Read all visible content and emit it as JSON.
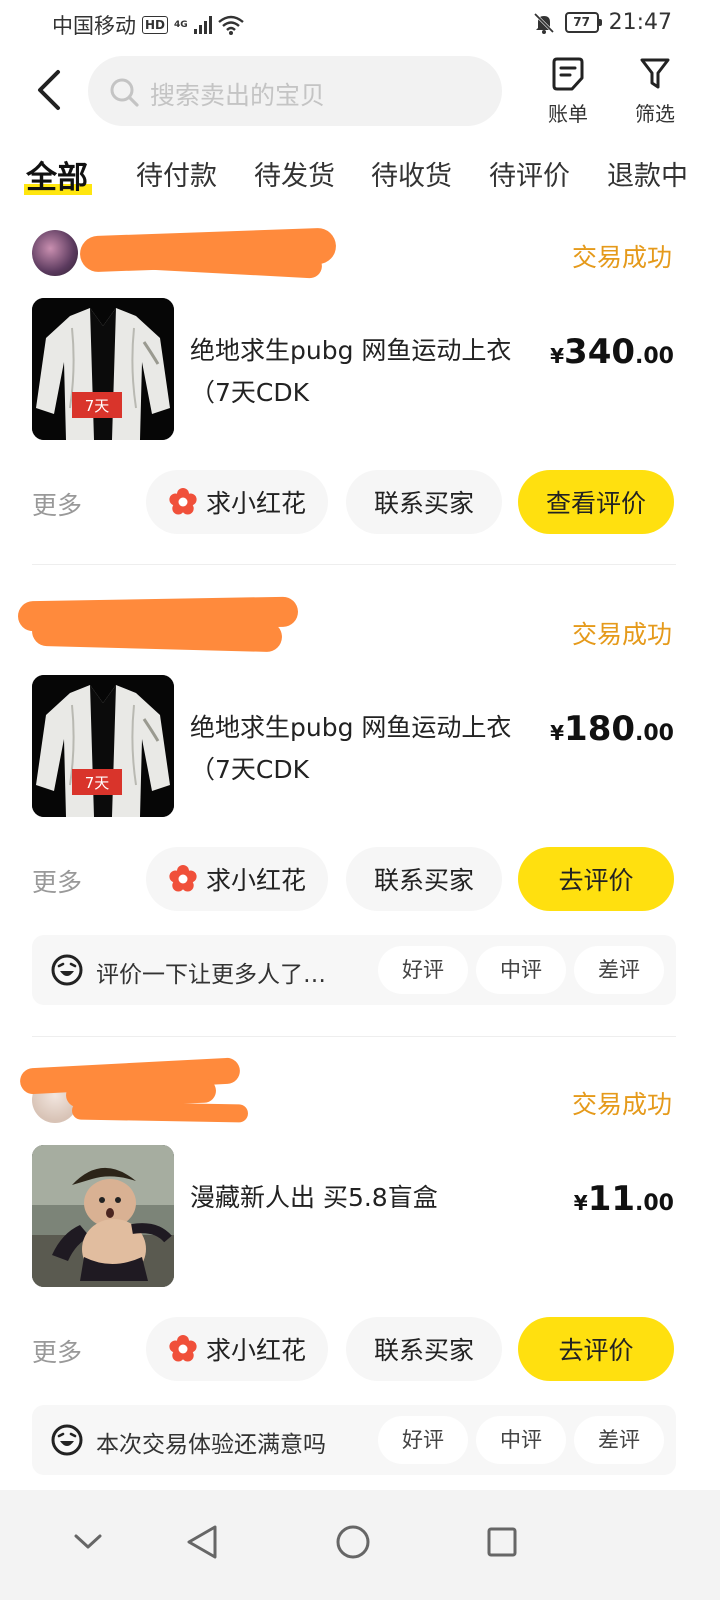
{
  "status_bar": {
    "carrier": "中国移动",
    "hd": "HD",
    "network": "4G",
    "battery": "77",
    "time": "21:47"
  },
  "header": {
    "search_placeholder": "搜索卖出的宝贝",
    "bill_label": "账单",
    "filter_label": "筛选"
  },
  "tabs": [
    {
      "label": "全部",
      "active": true
    },
    {
      "label": "待付款"
    },
    {
      "label": "待发货"
    },
    {
      "label": "待收货"
    },
    {
      "label": "待评价"
    },
    {
      "label": "退款中"
    }
  ],
  "orders": [
    {
      "status": "交易成功",
      "title": "绝地求生pubg 网鱼运动上衣（7天CDK",
      "thumb_badge": "7天",
      "price_currency": "¥",
      "price_int": "340",
      "price_dec": ".00",
      "more_label": "更多",
      "flower_label": "求小红花",
      "contact_label": "联系买家",
      "primary_label": "查看评价"
    },
    {
      "status": "交易成功",
      "title": "绝地求生pubg 网鱼运动上衣（7天CDK",
      "thumb_badge": "7天",
      "price_currency": "¥",
      "price_int": "180",
      "price_dec": ".00",
      "more_label": "更多",
      "flower_label": "求小红花",
      "contact_label": "联系买家",
      "primary_label": "去评价",
      "rate_prompt": "评价一下让更多人了…",
      "rate_good": "好评",
      "rate_mid": "中评",
      "rate_bad": "差评"
    },
    {
      "status": "交易成功",
      "title": "漫藏新人出 买5.8盲盒",
      "price_currency": "¥",
      "price_int": "11",
      "price_dec": ".00",
      "more_label": "更多",
      "flower_label": "求小红花",
      "contact_label": "联系买家",
      "primary_label": "去评价",
      "rate_prompt": "本次交易体验还满意吗",
      "rate_good": "好评",
      "rate_mid": "中评",
      "rate_bad": "差评"
    }
  ],
  "colors": {
    "accent_yellow": "#ffe00f",
    "status_orange": "#e59a1b",
    "redaction": "#ff8a3c"
  }
}
